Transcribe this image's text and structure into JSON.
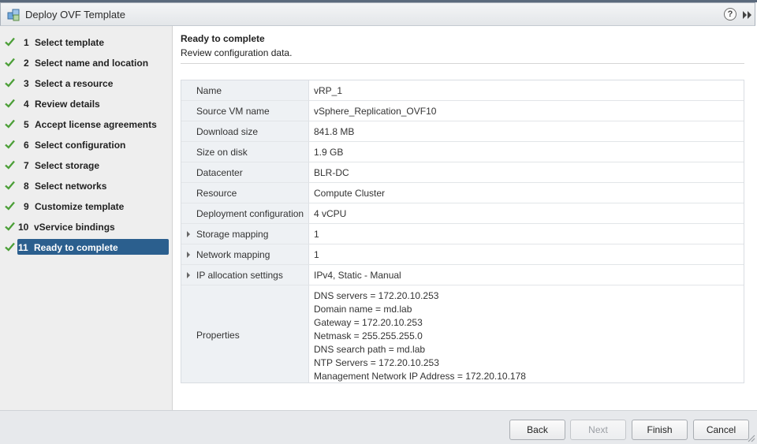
{
  "window": {
    "title": "Deploy OVF Template",
    "help_glyph": "?",
    "accent_color": "#2b5f8e",
    "check_color": "#4c9f38"
  },
  "steps": [
    {
      "num": "1",
      "label": "Select template",
      "done": true
    },
    {
      "num": "2",
      "label": "Select name and location",
      "done": true
    },
    {
      "num": "3",
      "label": "Select a resource",
      "done": true
    },
    {
      "num": "4",
      "label": "Review details",
      "done": true
    },
    {
      "num": "5",
      "label": "Accept license agreements",
      "done": true
    },
    {
      "num": "6",
      "label": "Select configuration",
      "done": true
    },
    {
      "num": "7",
      "label": "Select storage",
      "done": true
    },
    {
      "num": "8",
      "label": "Select networks",
      "done": true
    },
    {
      "num": "9",
      "label": "Customize template",
      "done": true
    },
    {
      "num": "10",
      "label": "vService bindings",
      "done": true
    },
    {
      "num": "11",
      "label": "Ready to complete",
      "done": true,
      "active": true
    }
  ],
  "content": {
    "title": "Ready to complete",
    "subtitle": "Review configuration data.",
    "rows": [
      {
        "key": "Name",
        "value": "vRP_1"
      },
      {
        "key": "Source VM name",
        "value": "vSphere_Replication_OVF10"
      },
      {
        "key": "Download size",
        "value": "841.8 MB"
      },
      {
        "key": "Size on disk",
        "value": "1.9 GB"
      },
      {
        "key": "Datacenter",
        "value": "BLR-DC"
      },
      {
        "key": "Resource",
        "value": "Compute Cluster"
      },
      {
        "key": "Deployment configuration",
        "value": "4 vCPU"
      },
      {
        "key": "Storage mapping",
        "value": "1",
        "expandable": true
      },
      {
        "key": "Network mapping",
        "value": "1",
        "expandable": true
      },
      {
        "key": "IP allocation settings",
        "value": "IPv4, Static - Manual",
        "expandable": true
      }
    ],
    "properties": {
      "key": "Properties",
      "lines": [
        "DNS servers = 172.20.10.253",
        "Domain name = md.lab",
        "Gateway = 172.20.10.253",
        "Netmask = 255.255.255.0",
        "DNS search path = md.lab",
        "NTP Servers = 172.20.10.253",
        "Management Network IP Address = 172.20.10.178"
      ]
    }
  },
  "footer": {
    "back": "Back",
    "next": "Next",
    "finish": "Finish",
    "cancel": "Cancel"
  }
}
